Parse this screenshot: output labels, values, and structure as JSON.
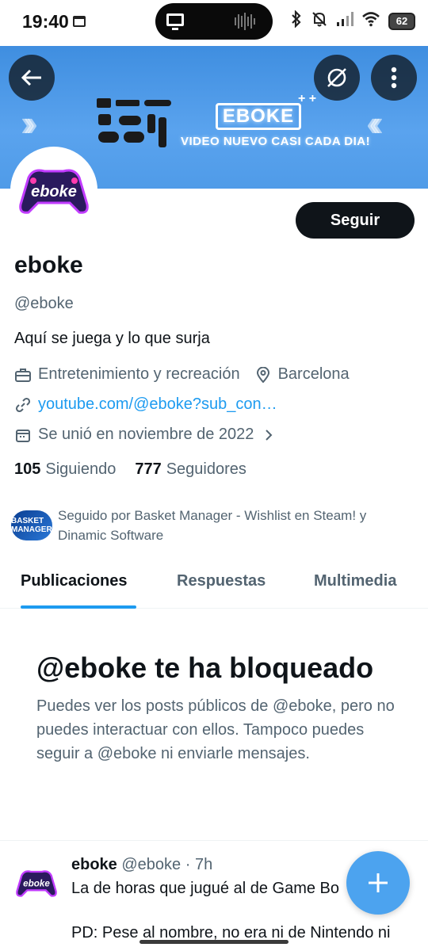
{
  "status_bar": {
    "time": "19:40",
    "battery": "62"
  },
  "banner": {
    "brand": "EBOKE",
    "tagline": "VIDEO NUEVO CASI CADA DIA!",
    "colors": {
      "background": "#4f9be8"
    }
  },
  "avatar": {
    "logo_text": "eboke"
  },
  "actions": {
    "follow_label": "Seguir"
  },
  "profile": {
    "name": "eboke",
    "handle": "@eboke",
    "bio": "Aquí se juega y lo que surja",
    "category": "Entretenimiento y recreación",
    "location": "Barcelona",
    "website": "youtube.com/@eboke?sub_con…",
    "joined": "Se unió en noviembre de 2022",
    "following_count": "105",
    "following_label": "Siguiendo",
    "followers_count": "777",
    "followers_label": "Seguidores",
    "followed_by": "Seguido por Basket Manager - Wishlist en Steam! y Dinamic Software",
    "followed_by_avatar_text": "BASKET MANAGER"
  },
  "tabs": [
    {
      "label": "Publicaciones",
      "active": true
    },
    {
      "label": "Respuestas",
      "active": false
    },
    {
      "label": "Multimedia",
      "active": false
    }
  ],
  "blocked": {
    "title": "@eboke te ha bloqueado",
    "message": "Puedes ver los posts públicos de @eboke, pero no puedes interactuar con ellos. Tampoco puedes seguir a @eboke ni enviarle mensajes."
  },
  "post": {
    "name": "eboke",
    "handle": "@eboke",
    "time": "· 7h",
    "text": "La de horas que jugué al de Game Bo",
    "text2": "PD: Pese al nombre, no era ni de Nintendo ni"
  },
  "icons": [
    "back-arrow-icon",
    "hide-icon",
    "more-vertical-icon",
    "briefcase-icon",
    "location-pin-icon",
    "link-icon",
    "calendar-icon",
    "chevron-right-icon",
    "compose-plus-icon"
  ],
  "colors": {
    "accent": "#1d9bf0",
    "text_primary": "#0f1419",
    "text_secondary": "#536471",
    "fab": "#4ca3ef"
  }
}
